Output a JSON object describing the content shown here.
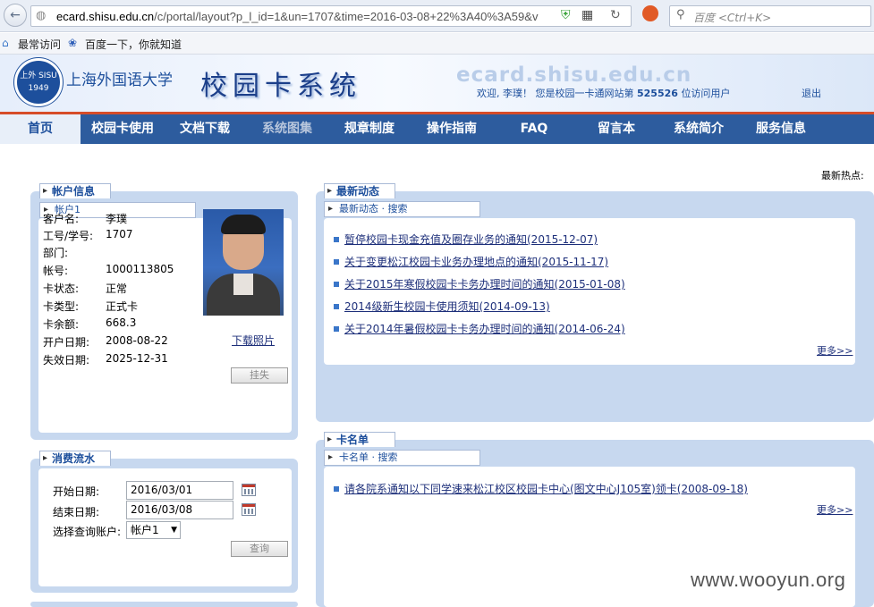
{
  "browser": {
    "url_host": "ecard.shisu.edu.cn",
    "url_path": "/c/portal/layout?p_l_id=1&un=1707&time=2016-03-08+22%3A40%3A59&v",
    "search_placeholder": "百度 <Ctrl+K>",
    "bookmarks": [
      "最常访问",
      "百度一下，你就知道"
    ]
  },
  "header": {
    "seal_text": "上外 SISU 1949",
    "university": "上海外国语大学",
    "system_title": "校园卡系统",
    "domain_watermark": "ecard.shisu.edu.cn",
    "welcome_prefix": "欢迎, 李璞！  您是校园一卡通网站第",
    "visitor_count": "525526",
    "welcome_suffix": "位访问用户",
    "logout": "退出"
  },
  "nav": [
    "首页",
    "校园卡使用",
    "文档下载",
    "系统图集",
    "规章制度",
    "操作指南",
    "FAQ",
    "留言本",
    "系统简介",
    "服务信息"
  ],
  "hot_label": "最新热点:",
  "account": {
    "tab": "帐户信息",
    "subtab": "帐户1",
    "fields": [
      {
        "label": "客户名:",
        "value": "李璞"
      },
      {
        "label": "工号/学号:",
        "value": "1707"
      },
      {
        "label": "部门:",
        "value": ""
      },
      {
        "label": "帐号:",
        "value": "1000113805"
      },
      {
        "label": "卡状态:",
        "value": "正常"
      },
      {
        "label": "卡类型:",
        "value": "正式卡"
      },
      {
        "label": "卡余额:",
        "value": "668.3"
      },
      {
        "label": "开户日期:",
        "value": "2008-08-22"
      },
      {
        "label": "失效日期:",
        "value": "2025-12-31"
      }
    ],
    "download_photo": "下载照片",
    "report_loss": "挂失"
  },
  "news": {
    "tab": "最新动态",
    "subtab": "最新动态 · 搜索",
    "items": [
      "暂停校园卡现金充值及圈存业务的通知(2015-12-07)",
      "关于变更松江校园卡业务办理地点的通知(2015-11-17)",
      "关于2015年寒假校园卡卡务办理时间的通知(2015-01-08)",
      "2014级新生校园卡使用须知(2014-09-13)",
      "关于2014年暑假校园卡卡务办理时间的通知(2014-06-24)"
    ],
    "more": "更多>>"
  },
  "consume": {
    "tab": "消费流水",
    "start_label": "开始日期:",
    "start_value": "2016/03/01",
    "end_label": "结束日期:",
    "end_value": "2016/03/08",
    "account_label": "选择查询账户:",
    "account_value": "帐户1",
    "query": "查询"
  },
  "cardlist": {
    "tab": "卡名单",
    "subtab": "卡名单 · 搜索",
    "items": [
      "请各院系通知以下同学速来松江校区校园卡中心(图文中心J105室)领卡(2008-09-18)"
    ],
    "more": "更多>>"
  },
  "watermark": "www.wooyun.org"
}
